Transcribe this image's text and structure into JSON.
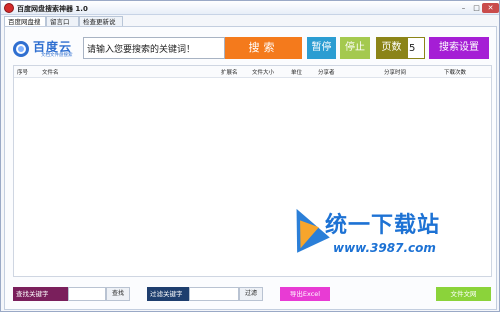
{
  "window": {
    "title": "百度网盘搜索神器 1.0",
    "controls": [
      "–",
      "□",
      "✕"
    ]
  },
  "tabs": [
    "百度网盘搜索",
    "留言口水",
    "检查更新说明"
  ],
  "logo": {
    "name": "百度云",
    "sub": "文档文件盘搜索"
  },
  "search": {
    "value": "请输入您要搜索的关键词！"
  },
  "buttons": {
    "search": "搜索",
    "pause": "暂停",
    "stop": "停止",
    "pages_label": "页数",
    "pages_value": "5",
    "settings": "搜索设置"
  },
  "columns": [
    "序号",
    "文件名",
    "扩展名",
    "文件大小",
    "单位",
    "分享者",
    "分享时间",
    "下载次数"
  ],
  "bottom": {
    "find_label": "查找关键字",
    "find_button": "查找",
    "filter_label": "过滤关键字",
    "filter_button": "过滤",
    "export_excel": "导出Excel",
    "export_text": "文件文网"
  },
  "watermark": {
    "brand": "统一下载站",
    "url": "www.3987.com"
  },
  "colors": {
    "search": "#f47a1c",
    "pause": "#2b9dd2",
    "stop": "#a4c94f",
    "pages": "#8b8418",
    "settings": "#a51ed5",
    "find": "#7a1f5c",
    "filter": "#1e3e6e",
    "excel": "#e83bd4",
    "text": "#8bd33a"
  }
}
